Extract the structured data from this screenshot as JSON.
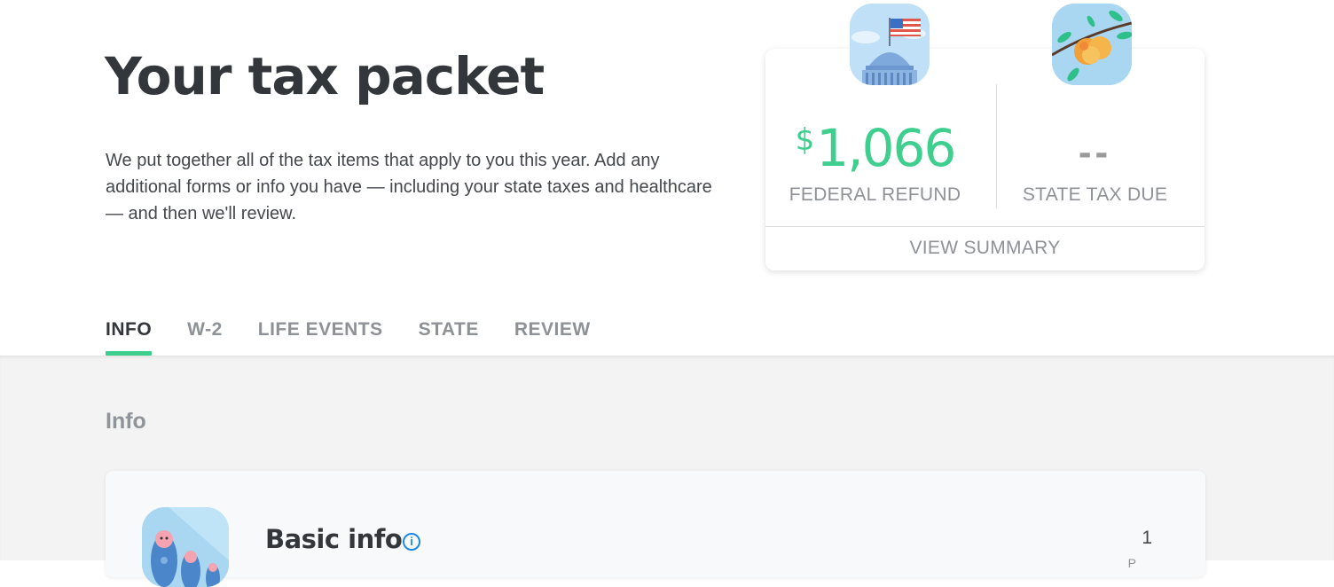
{
  "header": {
    "title": "Your tax packet",
    "intro": "We put together all of the tax items that apply to you this year. Add any additional forms or info you have — including your state taxes and healthcare — and then we'll review."
  },
  "summary_card": {
    "federal": {
      "currency": "$",
      "amount": "1,066",
      "label": "FEDERAL REFUND",
      "icon": "capitol-flag-icon"
    },
    "state": {
      "amount": "--",
      "label": "STATE TAX DUE",
      "icon": "peach-branch-icon"
    },
    "view_summary_label": "VIEW SUMMARY"
  },
  "tabs": [
    {
      "label": "INFO",
      "active": true
    },
    {
      "label": "W-2",
      "active": false
    },
    {
      "label": "LIFE EVENTS",
      "active": false
    },
    {
      "label": "STATE",
      "active": false
    },
    {
      "label": "REVIEW",
      "active": false
    }
  ],
  "section": {
    "title": "Info",
    "cards": [
      {
        "title": "Basic info",
        "icon": "nesting-dolls-icon",
        "help_icon": "info-circle-icon",
        "help_glyph": "i",
        "count": "1",
        "count_sub": "P"
      }
    ]
  },
  "colors": {
    "accent_green": "#3ecf8e",
    "help_blue": "#1e88e5",
    "text_dark": "#33363b",
    "text_muted": "#8e9196",
    "panel_bg": "#f3f3f3"
  }
}
